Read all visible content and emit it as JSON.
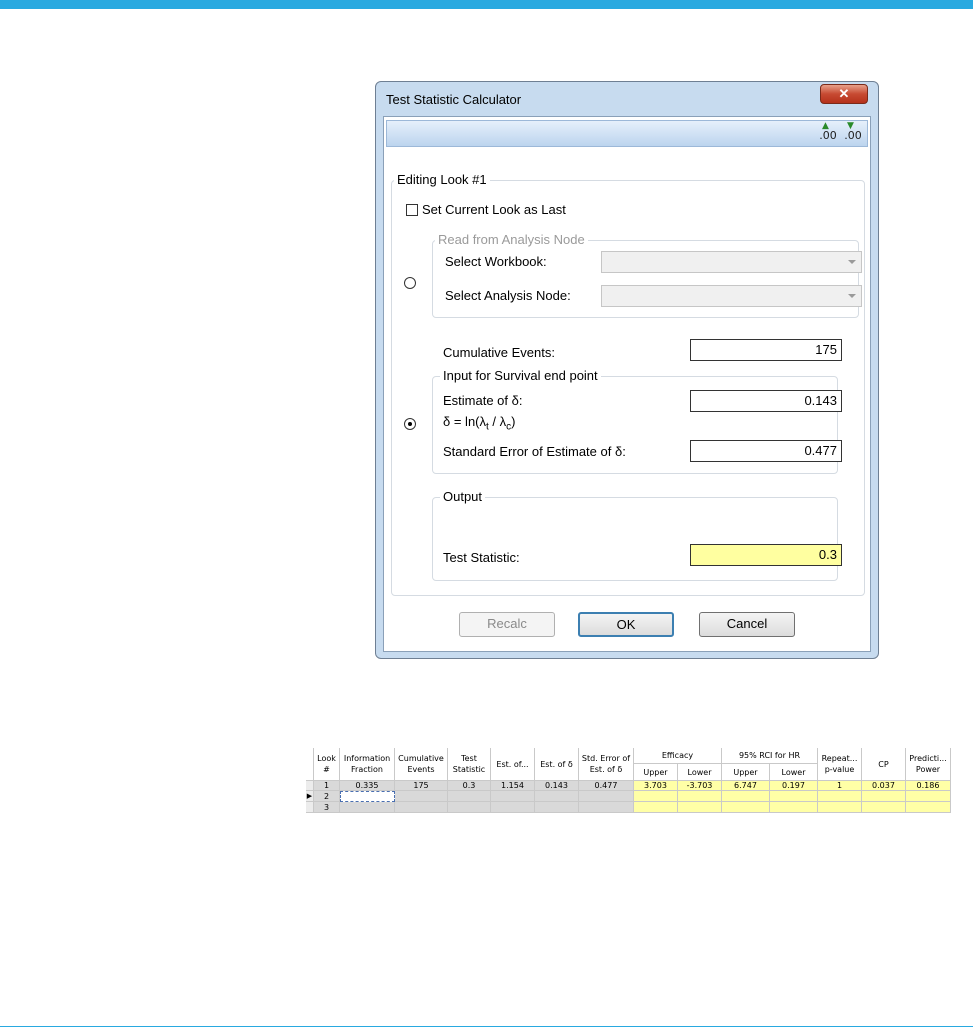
{
  "dialog": {
    "title": "Test Statistic Calculator",
    "close_label": "✕",
    "toolbar": {
      "increase_decimals": ".00",
      "decrease_decimals": ".00"
    },
    "editing_group": "Editing Look #1",
    "set_last_label": "Set Current Look as Last",
    "set_last_checked": false,
    "analysis_node": {
      "legend": "Read from Analysis Node",
      "workbook_label": "Select Workbook:",
      "node_label": "Select Analysis Node:",
      "selected": false
    },
    "manual": {
      "selected": true,
      "cum_events_label": "Cumulative Events:",
      "cum_events_value": "175",
      "survival_legend": "Input for Survival end point",
      "estimate_label": "Estimate of δ:",
      "formula_prefix": "δ = ln(λ",
      "formula_sub_t": "t",
      "formula_mid": " / λ",
      "formula_sub_c": "c",
      "formula_suffix": ")",
      "estimate_value": "0.143",
      "se_label": "Standard Error of Estimate of δ:",
      "se_value": "0.477"
    },
    "output": {
      "legend": "Output",
      "test_stat_label": "Test Statistic:",
      "test_stat_value": "0.3"
    },
    "buttons": {
      "recalc": "Recalc",
      "ok": "OK",
      "cancel": "Cancel"
    }
  },
  "grid": {
    "headers": {
      "look": "Look",
      "look_sub": "#",
      "info": "Information",
      "info_sub": "Fraction",
      "cum": "Cumulative",
      "cum_sub": "Events",
      "test": "Test",
      "test_sub": "Statistic",
      "est_of": "Est. of...",
      "est_delta": "Est. of δ",
      "std_err": "Std. Error of",
      "std_err_sub": "Est. of δ",
      "efficacy": "Efficacy",
      "eff_upper": "Upper",
      "eff_lower": "Lower",
      "rci": "95% RCI for HR",
      "rci_upper": "Upper",
      "rci_lower": "Lower",
      "repeat": "Repeat...",
      "repeat_sub": "p-value",
      "cp": "CP",
      "pred": "Predicti...",
      "pred_sub": "Power"
    },
    "rows": [
      {
        "look": "1",
        "info": "0.335",
        "cum": "175",
        "test": "0.3",
        "est_of": "1.154",
        "est_delta": "0.143",
        "std_err": "0.477",
        "eff_upper": "3.703",
        "eff_lower": "-3.703",
        "rci_upper": "6.747",
        "rci_lower": "0.197",
        "repeat": "1",
        "cp": "0.037",
        "pred": "0.186"
      },
      {
        "look": "2"
      },
      {
        "look": "3"
      }
    ],
    "current_row_marker": "▶"
  }
}
